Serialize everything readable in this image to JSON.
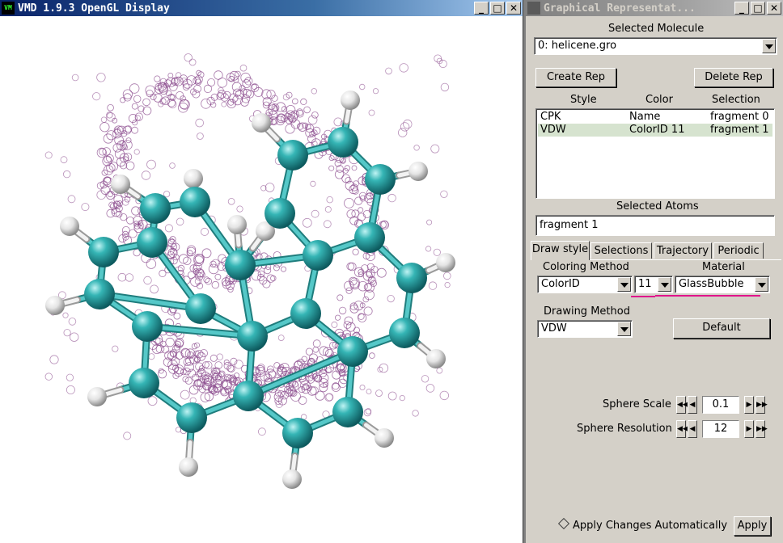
{
  "gl_window": {
    "title": "VMD 1.9.3 OpenGL Display",
    "app_icon_text": "VM",
    "controls": {
      "minimize": "_",
      "maximize": "□",
      "close": "✕"
    }
  },
  "graphics_window": {
    "title": "Graphical Representat...",
    "controls": {
      "minimize": "_",
      "maximize": "□",
      "close": "✕"
    },
    "selected_molecule_label": "Selected Molecule",
    "selected_molecule_value": "0: helicene.gro",
    "create_rep_label": "Create Rep",
    "delete_rep_label": "Delete Rep",
    "rep_columns": [
      "Style",
      "Color",
      "Selection"
    ],
    "reps": [
      {
        "style": "CPK",
        "color": "Name",
        "selection": "fragment 0",
        "selected": false
      },
      {
        "style": "VDW",
        "color": "ColorID 11",
        "selection": "fragment 1",
        "selected": true
      }
    ],
    "selected_atoms_label": "Selected Atoms",
    "selected_atoms_value": "fragment 1",
    "tabs": [
      "Draw style",
      "Selections",
      "Trajectory",
      "Periodic"
    ],
    "active_tab": "Draw style",
    "coloring_method_label": "Coloring Method",
    "coloring_method_value": "ColorID",
    "color_id_value": "11",
    "material_label": "Material",
    "material_value": "GlassBubble",
    "drawing_method_label": "Drawing Method",
    "drawing_method_value": "VDW",
    "default_label": "Default",
    "sphere_scale_label": "Sphere Scale",
    "sphere_scale_value": "0.1",
    "sphere_resolution_label": "Sphere Resolution",
    "sphere_resolution_value": "12",
    "apply_auto_label": "Apply Changes Automatically",
    "apply_auto_checked": false,
    "apply_label": "Apply",
    "highlight_color": "#e0138c"
  },
  "scene_colors": {
    "carbon": "#2aa6a6",
    "hydrogen": "#e8e8e8",
    "bubbles": "#8a4a8c",
    "background": "#ffffff"
  }
}
